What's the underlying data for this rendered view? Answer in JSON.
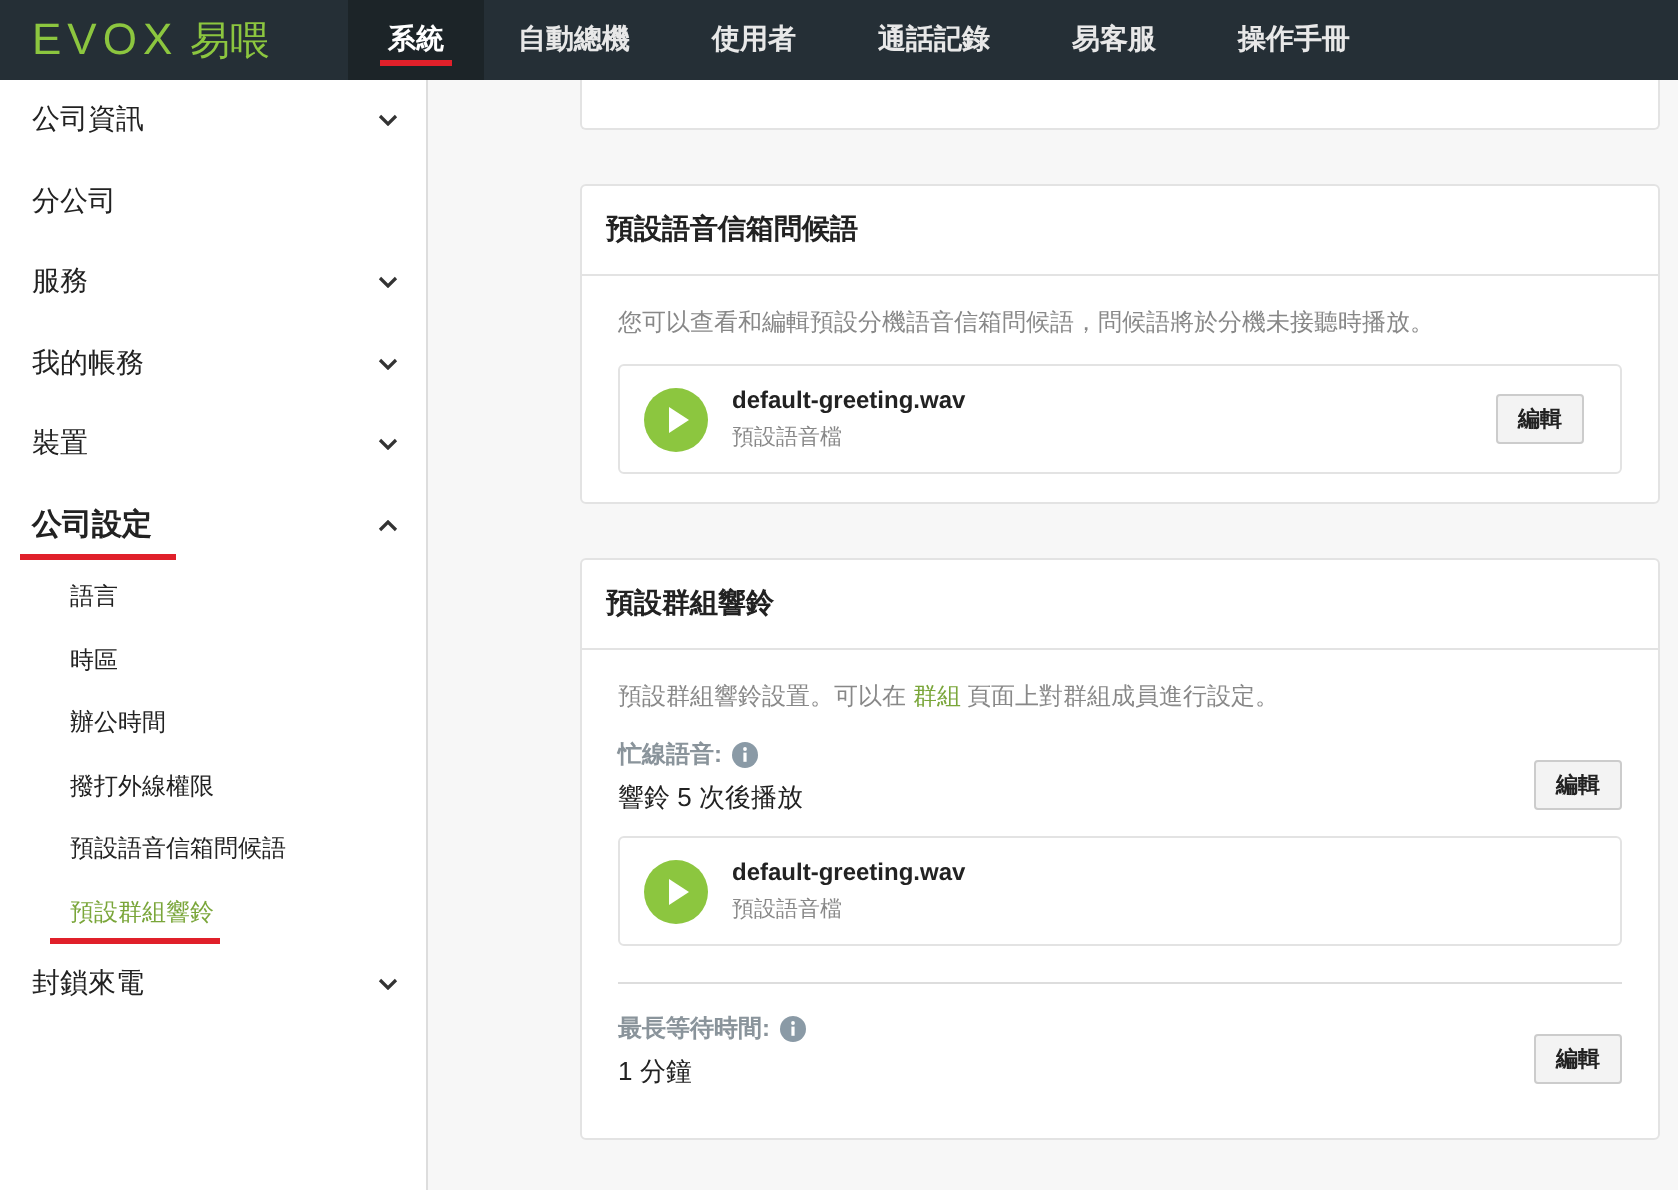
{
  "nav": {
    "logo_mark": "EVOX",
    "logo_text": "易喂",
    "tabs": [
      {
        "label": "系統",
        "selected": true
      },
      {
        "label": "自動總機",
        "selected": false
      },
      {
        "label": "使用者",
        "selected": false
      },
      {
        "label": "通話記錄",
        "selected": false
      },
      {
        "label": "易客服",
        "selected": false
      },
      {
        "label": "操作手冊",
        "selected": false
      }
    ]
  },
  "sidebar": {
    "items": [
      {
        "label": "公司資訊",
        "expandable": true,
        "expanded": false,
        "selected": false
      },
      {
        "label": "分公司",
        "selected": false
      },
      {
        "label": "服務",
        "expandable": true,
        "expanded": false,
        "selected": false
      },
      {
        "label": "我的帳務",
        "expandable": true,
        "expanded": false,
        "selected": false
      },
      {
        "label": "裝置",
        "expandable": true,
        "expanded": false,
        "selected": false
      },
      {
        "label": "公司設定",
        "expandable": true,
        "expanded": true,
        "selected": true,
        "children": [
          {
            "label": "語言",
            "selected": false
          },
          {
            "label": "時區",
            "selected": false
          },
          {
            "label": "辦公時間",
            "selected": false
          },
          {
            "label": "撥打外線權限",
            "selected": false
          },
          {
            "label": "預設語音信箱問候語",
            "selected": false
          },
          {
            "label": "預設群組響鈴",
            "selected": true
          }
        ]
      },
      {
        "label": "封鎖來電",
        "expandable": true,
        "expanded": false,
        "selected": false
      }
    ]
  },
  "cards": [
    {
      "kind": "cut"
    },
    {
      "kind": "full",
      "title": "預設語音信箱問候語",
      "blocks": [
        {
          "kind": "description",
          "text": "您可以查看和編輯預設分機語音信箱問候語，問候語將於分機未接聽時播放。"
        },
        {
          "kind": "file",
          "name": "default-greeting.wav",
          "subtitle": "預設語音檔",
          "button": "編輯"
        }
      ]
    },
    {
      "kind": "full",
      "title": "預設群組響鈴",
      "blocks": [
        {
          "kind": "link_description",
          "before": "預設群組響鈴設置。可以在 ",
          "link": "群組",
          "after": " 頁面上對群組成員進行設定。"
        },
        {
          "kind": "setting",
          "label": "忙線語音:",
          "value": "響鈴 5 次後播放",
          "button": "編輯"
        },
        {
          "kind": "file",
          "name": "default-greeting.wav",
          "subtitle": "預設語音檔"
        },
        {
          "kind": "divider"
        },
        {
          "kind": "setting",
          "label": "最長等待時間:",
          "value": "1 分鐘",
          "button": "編輯"
        }
      ]
    }
  ]
}
